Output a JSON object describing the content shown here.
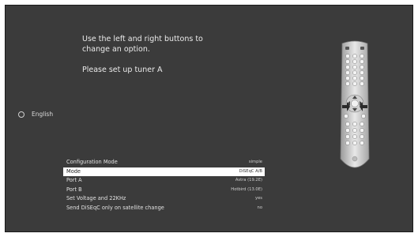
{
  "instructions": {
    "line1": "Use the left and right buttons to",
    "line2": "change an option.",
    "line3": "Please set up tuner A"
  },
  "language": {
    "label": "English"
  },
  "config": {
    "rows": [
      {
        "label": "Configuration Mode",
        "value": "simple",
        "selected": false
      },
      {
        "label": "Mode",
        "value": "DiSEqC A/B",
        "selected": true
      },
      {
        "label": "Port A",
        "value": "Astra (19.2E)",
        "selected": false
      },
      {
        "label": "Port B",
        "value": "Hotbird (13.0E)",
        "selected": false
      },
      {
        "label": "Set Voltage and 22KHz",
        "value": "yes",
        "selected": false
      },
      {
        "label": "Send DiSEqC only on satellite change",
        "value": "no",
        "selected": false
      }
    ]
  },
  "remote": {
    "icon": "remote-control-icon"
  },
  "colors": {
    "screen_bg": "#3b3b3b",
    "highlight": "#ffffff",
    "text": "#e2e2e2"
  }
}
